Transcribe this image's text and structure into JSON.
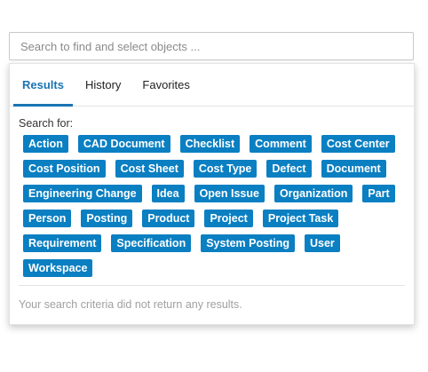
{
  "search": {
    "placeholder": "Search to find and select objects ...",
    "value": ""
  },
  "tabs": [
    {
      "label": "Results",
      "active": true
    },
    {
      "label": "History",
      "active": false
    },
    {
      "label": "Favorites",
      "active": false
    }
  ],
  "search_for_label": "Search for:",
  "object_types": [
    "Action",
    "CAD Document",
    "Checklist",
    "Comment",
    "Cost Center",
    "Cost Position",
    "Cost Sheet",
    "Cost Type",
    "Defect",
    "Document",
    "Engineering Change",
    "Idea",
    "Open Issue",
    "Organization",
    "Part",
    "Person",
    "Posting",
    "Product",
    "Project",
    "Project Task",
    "Requirement",
    "Specification",
    "System Posting",
    "User",
    "Workspace"
  ],
  "empty_message": "Your search criteria did not return any results.",
  "colors": {
    "accent": "#1a74b3",
    "chip_bg": "#0a7fc2",
    "muted_text": "#a0a0a0"
  }
}
